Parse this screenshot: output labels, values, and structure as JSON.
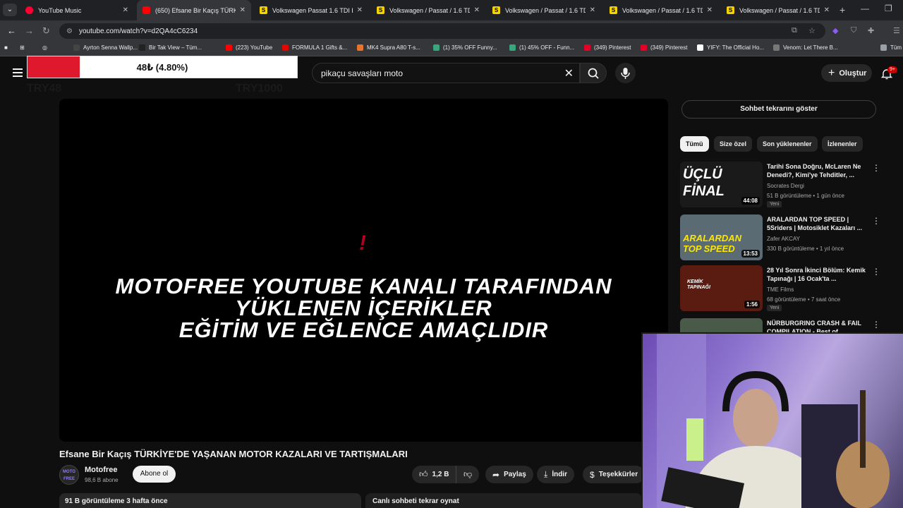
{
  "browser": {
    "tabs": [
      {
        "title": "YouTube Music",
        "fav": "ytm",
        "active": false
      },
      {
        "title": "(650) Efsane Bir Kaçış TÜRKİYE'D",
        "fav": "yt",
        "active": true
      },
      {
        "title": "Volkswagen Passat 1.6 TDI Blue",
        "fav": "s",
        "active": false
      },
      {
        "title": "Volkswagen / Passat / 1.6 TDI B",
        "fav": "s",
        "active": false
      },
      {
        "title": "Volkswagen / Passat / 1.6 TDI B",
        "fav": "s",
        "active": false
      },
      {
        "title": "Volkswagen / Passat / 1.6 TDI B",
        "fav": "s",
        "active": false
      },
      {
        "title": "Volkswagen / Passat / 1.6 TDI B",
        "fav": "s",
        "active": false
      }
    ],
    "url": "youtube.com/watch?v=d2QA4cC6234",
    "bookmarks": [
      {
        "label": "Ayrton Senna Wallp...",
        "color": "#444"
      },
      {
        "label": "Bir Tak View – Tüm...",
        "color": "#222"
      },
      {
        "label": "(223) YouTube",
        "color": "#ff0000"
      },
      {
        "label": "FORMULA 1 Gifts &...",
        "color": "#e10600"
      },
      {
        "label": "MK4 Supra A80 T-s...",
        "color": "#e8732a"
      },
      {
        "label": "(1) 35% OFF Funny...",
        "color": "#3aa57c"
      },
      {
        "label": "(1) 45% OFF - Funn...",
        "color": "#3aa57c"
      },
      {
        "label": "(349) Pinterest",
        "color": "#e60023"
      },
      {
        "label": "(349) Pinterest",
        "color": "#e60023"
      },
      {
        "label": "YIFY: The Official Ho...",
        "color": "#ffffff"
      },
      {
        "label": "Venom: Let There B...",
        "color": "#777"
      },
      {
        "label": "Tüm",
        "color": "#9aa0a6"
      }
    ]
  },
  "donation": {
    "label": "48₺ (4.80%)",
    "progress": 0.048,
    "min": "TRY48",
    "max": "TRY1000"
  },
  "search": {
    "query": "pikaçu savaşları moto"
  },
  "header": {
    "create_label": "Oluştur",
    "notif_badge": "9+"
  },
  "video": {
    "overlay_mark": "!",
    "disclaimer_lines": [
      "MOTOFREE YOUTUBE KANALI TARAFINDAN",
      "YÜKLENEN İÇERİKLER",
      "EĞİTİM VE EĞLENCE AMAÇLIDIR"
    ],
    "title": "Efsane Bir Kaçış TÜRKİYE'DE YAŞANAN MOTOR KAZALARI VE TARTIŞMALARI",
    "channel": "Motofree",
    "avatar_text": "MOTO FREE",
    "subscribers": "98,6 B abone",
    "subscribe_label": "Abone ol",
    "likes": "1,2 B",
    "share_label": "Paylaş",
    "download_label": "İndir",
    "thanks_label": "Teşekkürler",
    "views_line": "91 B görüntüleme  3 hafta önce",
    "chat_replay": "Canlı sohbeti tekrar oynat"
  },
  "sidebar": {
    "chat_button": "Sohbet tekrarını göster",
    "chips": [
      "Tümü",
      "Size özel",
      "Son yüklenenler",
      "İzlenenler"
    ],
    "recommendations": [
      {
        "title": "Tarihi Sona Doğru, McLaren Ne Denedi?, Kimi'ye Tehditler, ...",
        "channel": "Socrates Dergi",
        "meta": "51 B görüntüleme • 1 gün önce",
        "duration": "44:08",
        "new": "Yeni",
        "thumb_text": "ÜÇLÜ FİNAL",
        "thumb_color": "#1a1a1a"
      },
      {
        "title": "ARALARDAN TOP SPEED | 5Sriders | Motosiklet Kazaları ...",
        "channel": "Zafer AKCAY",
        "meta": "330 B görüntüleme • 1 yıl önce",
        "duration": "13:53",
        "new": "",
        "thumb_text": "ARALARDAN TOP SPEED",
        "thumb_color": "#5a6b73"
      },
      {
        "title": "28 Yıl Sonra İkinci Bölüm: Kemik Tapınağı | 16 Ocak'ta ...",
        "channel": "TME Films",
        "meta": "68 görüntüleme • 7 saat önce",
        "duration": "1:56",
        "new": "Yeni",
        "thumb_text": "KEMİK TAPINAĞI",
        "thumb_color": "#5a1c10"
      },
      {
        "title": "NÜRBURGRING CRASH & FAIL COMPILATION - Best of ...",
        "channel": "",
        "meta": "",
        "duration": "",
        "new": "",
        "thumb_text": "",
        "thumb_color": "#4a5a48"
      }
    ]
  },
  "colors": {
    "accent": "#ff0000",
    "bg": "#0f0f0f",
    "surface": "#272727",
    "donation_fill": "#e0182d"
  }
}
